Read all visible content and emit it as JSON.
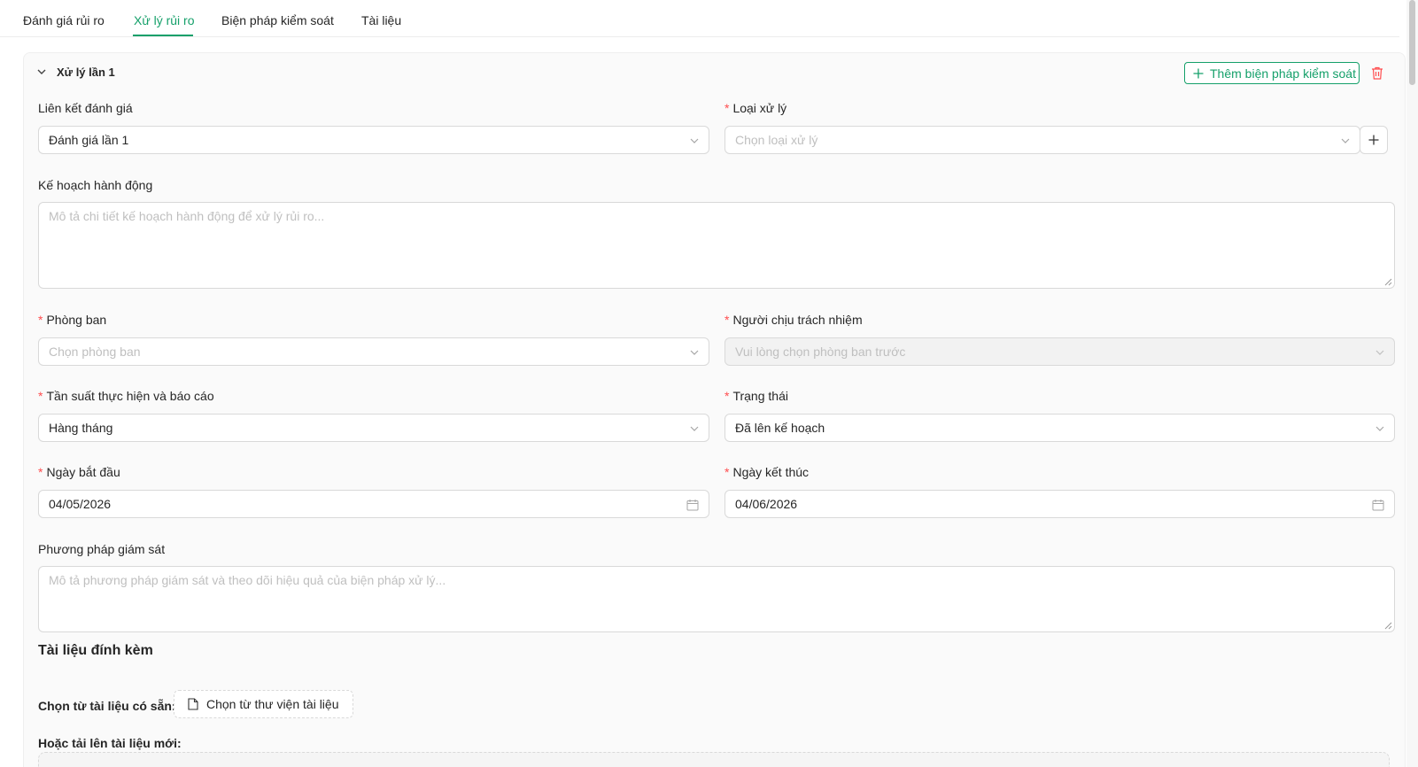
{
  "tabs": [
    {
      "label": "Đánh giá rủi ro"
    },
    {
      "label": "Xử lý rủi ro"
    },
    {
      "label": "Biện pháp kiểm soát"
    },
    {
      "label": "Tài liệu"
    }
  ],
  "active_tab": "Xử lý rủi ro",
  "treatment": {
    "title": "Xử lý lần 1",
    "add_control_label": "Thêm biện pháp kiểm soát"
  },
  "fields": {
    "assessment_link": {
      "label": "Liên kết đánh giá",
      "value": "Đánh giá lần 1"
    },
    "treatment_type": {
      "label": "Loại xử lý",
      "placeholder": "Chọn loại xử lý"
    },
    "action_plan": {
      "label": "Kế hoạch hành động",
      "placeholder": "Mô tả chi tiết kế hoạch hành động để xử lý rủi ro..."
    },
    "department": {
      "label": "Phòng ban",
      "placeholder": "Chọn phòng ban"
    },
    "owner": {
      "label": "Người chịu trách nhiệm",
      "placeholder": "Vui lòng chọn phòng ban trước"
    },
    "frequency": {
      "label": "Tần suất thực hiện và báo cáo",
      "value": "Hàng tháng"
    },
    "status": {
      "label": "Trạng thái",
      "value": "Đã lên kế hoạch"
    },
    "start_date": {
      "label": "Ngày bắt đầu",
      "value": "04/05/2026"
    },
    "end_date": {
      "label": "Ngày kết thúc",
      "value": "04/06/2026"
    },
    "monitoring": {
      "label": "Phương pháp giám sát",
      "placeholder": "Mô tả phương pháp giám sát và theo dõi hiệu quả của biện pháp xử lý..."
    }
  },
  "attachments": {
    "title": "Tài liệu đính kèm",
    "choose_existing_label": "Chọn từ tài liệu có sẵn:",
    "library_button": "Chọn từ thư viện tài liệu",
    "upload_new_label": "Hoặc tải lên tài liệu mới:"
  },
  "colors": {
    "accent": "#15a06a",
    "required": "#ff4d4f",
    "danger": "#ff4d4f"
  }
}
